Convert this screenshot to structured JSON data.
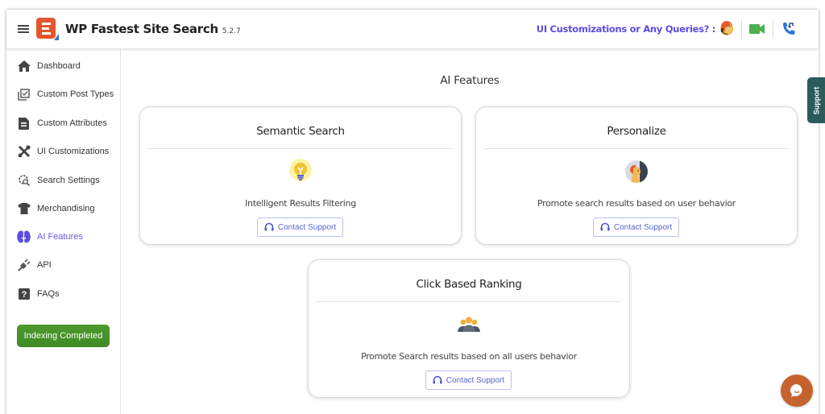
{
  "header": {
    "menu_icon": "hamburger-icon",
    "logo": "wp-fastest-site-search-logo",
    "title": "WP Fastest Site Search",
    "version": "5.2.7",
    "queries_label": "UI Customizations or Any Queries? :",
    "icons": [
      "support-agent-icon",
      "video-call-icon",
      "phone-callback-icon"
    ]
  },
  "sidebar": {
    "items": [
      {
        "label": "Dashboard",
        "icon": "home-icon",
        "active": false
      },
      {
        "label": "Custom Post Types",
        "icon": "checkbox-stack-icon",
        "active": false
      },
      {
        "label": "Custom Attributes",
        "icon": "document-icon",
        "active": false
      },
      {
        "label": "UI Customizations",
        "icon": "tools-icon",
        "active": false
      },
      {
        "label": "Search Settings",
        "icon": "search-settings-icon",
        "active": false
      },
      {
        "label": "Merchandising",
        "icon": "shirt-icon",
        "active": false
      },
      {
        "label": "AI Features",
        "icon": "brain-icon",
        "active": true
      },
      {
        "label": "API",
        "icon": "plug-icon",
        "active": false
      },
      {
        "label": "FAQs",
        "icon": "question-icon",
        "active": false
      }
    ],
    "status_button": "Indexing Completed"
  },
  "main": {
    "title": "AI Features",
    "cards": [
      {
        "title": "Semantic Search",
        "icon": "lightbulb-icon",
        "description": "Intelligent Results Filtering",
        "button": "Contact Support"
      },
      {
        "title": "Personalize",
        "icon": "user-profile-icon",
        "description": "Promote search results based on user behavior",
        "button": "Contact Support"
      },
      {
        "title": "Click Based Ranking",
        "icon": "users-group-icon",
        "description": "Promote Search results based on all users behavior",
        "button": "Contact Support"
      }
    ]
  },
  "floating": {
    "support_tab": "Support",
    "chat_icon": "chat-bubble-icon"
  },
  "colors": {
    "accent": "#6b5be6",
    "queries_text": "#5b4de3",
    "indexing_green": "#4a952b",
    "support_tab": "#2c5c5a",
    "chat_bubble": "#c6622d",
    "logo_red": "#e4572e"
  }
}
